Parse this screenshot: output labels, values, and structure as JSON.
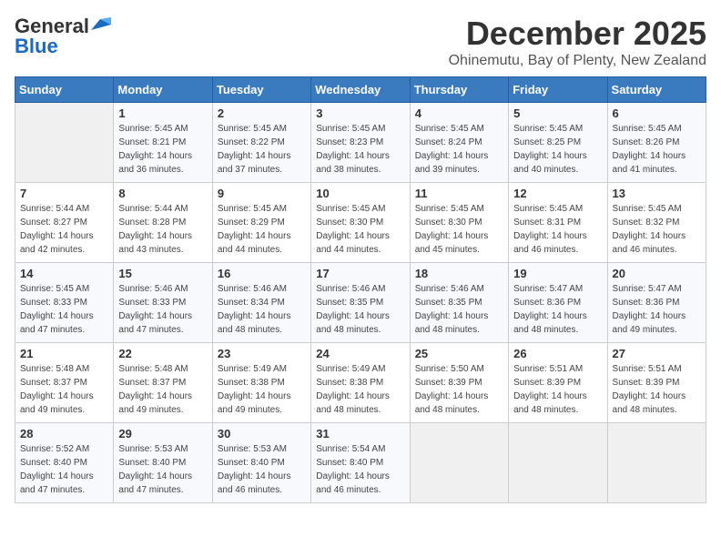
{
  "logo": {
    "line1": "General",
    "line2": "Blue"
  },
  "title": "December 2025",
  "location": "Ohinemutu, Bay of Plenty, New Zealand",
  "weekdays": [
    "Sunday",
    "Monday",
    "Tuesday",
    "Wednesday",
    "Thursday",
    "Friday",
    "Saturday"
  ],
  "weeks": [
    [
      {
        "day": null
      },
      {
        "day": 1,
        "sunrise": "5:45 AM",
        "sunset": "8:21 PM",
        "daylight": "14 hours and 36 minutes."
      },
      {
        "day": 2,
        "sunrise": "5:45 AM",
        "sunset": "8:22 PM",
        "daylight": "14 hours and 37 minutes."
      },
      {
        "day": 3,
        "sunrise": "5:45 AM",
        "sunset": "8:23 PM",
        "daylight": "14 hours and 38 minutes."
      },
      {
        "day": 4,
        "sunrise": "5:45 AM",
        "sunset": "8:24 PM",
        "daylight": "14 hours and 39 minutes."
      },
      {
        "day": 5,
        "sunrise": "5:45 AM",
        "sunset": "8:25 PM",
        "daylight": "14 hours and 40 minutes."
      },
      {
        "day": 6,
        "sunrise": "5:45 AM",
        "sunset": "8:26 PM",
        "daylight": "14 hours and 41 minutes."
      }
    ],
    [
      {
        "day": 7,
        "sunrise": "5:44 AM",
        "sunset": "8:27 PM",
        "daylight": "14 hours and 42 minutes."
      },
      {
        "day": 8,
        "sunrise": "5:44 AM",
        "sunset": "8:28 PM",
        "daylight": "14 hours and 43 minutes."
      },
      {
        "day": 9,
        "sunrise": "5:45 AM",
        "sunset": "8:29 PM",
        "daylight": "14 hours and 44 minutes."
      },
      {
        "day": 10,
        "sunrise": "5:45 AM",
        "sunset": "8:30 PM",
        "daylight": "14 hours and 44 minutes."
      },
      {
        "day": 11,
        "sunrise": "5:45 AM",
        "sunset": "8:30 PM",
        "daylight": "14 hours and 45 minutes."
      },
      {
        "day": 12,
        "sunrise": "5:45 AM",
        "sunset": "8:31 PM",
        "daylight": "14 hours and 46 minutes."
      },
      {
        "day": 13,
        "sunrise": "5:45 AM",
        "sunset": "8:32 PM",
        "daylight": "14 hours and 46 minutes."
      }
    ],
    [
      {
        "day": 14,
        "sunrise": "5:45 AM",
        "sunset": "8:33 PM",
        "daylight": "14 hours and 47 minutes."
      },
      {
        "day": 15,
        "sunrise": "5:46 AM",
        "sunset": "8:33 PM",
        "daylight": "14 hours and 47 minutes."
      },
      {
        "day": 16,
        "sunrise": "5:46 AM",
        "sunset": "8:34 PM",
        "daylight": "14 hours and 48 minutes."
      },
      {
        "day": 17,
        "sunrise": "5:46 AM",
        "sunset": "8:35 PM",
        "daylight": "14 hours and 48 minutes."
      },
      {
        "day": 18,
        "sunrise": "5:46 AM",
        "sunset": "8:35 PM",
        "daylight": "14 hours and 48 minutes."
      },
      {
        "day": 19,
        "sunrise": "5:47 AM",
        "sunset": "8:36 PM",
        "daylight": "14 hours and 48 minutes."
      },
      {
        "day": 20,
        "sunrise": "5:47 AM",
        "sunset": "8:36 PM",
        "daylight": "14 hours and 49 minutes."
      }
    ],
    [
      {
        "day": 21,
        "sunrise": "5:48 AM",
        "sunset": "8:37 PM",
        "daylight": "14 hours and 49 minutes."
      },
      {
        "day": 22,
        "sunrise": "5:48 AM",
        "sunset": "8:37 PM",
        "daylight": "14 hours and 49 minutes."
      },
      {
        "day": 23,
        "sunrise": "5:49 AM",
        "sunset": "8:38 PM",
        "daylight": "14 hours and 49 minutes."
      },
      {
        "day": 24,
        "sunrise": "5:49 AM",
        "sunset": "8:38 PM",
        "daylight": "14 hours and 48 minutes."
      },
      {
        "day": 25,
        "sunrise": "5:50 AM",
        "sunset": "8:39 PM",
        "daylight": "14 hours and 48 minutes."
      },
      {
        "day": 26,
        "sunrise": "5:51 AM",
        "sunset": "8:39 PM",
        "daylight": "14 hours and 48 minutes."
      },
      {
        "day": 27,
        "sunrise": "5:51 AM",
        "sunset": "8:39 PM",
        "daylight": "14 hours and 48 minutes."
      }
    ],
    [
      {
        "day": 28,
        "sunrise": "5:52 AM",
        "sunset": "8:40 PM",
        "daylight": "14 hours and 47 minutes."
      },
      {
        "day": 29,
        "sunrise": "5:53 AM",
        "sunset": "8:40 PM",
        "daylight": "14 hours and 47 minutes."
      },
      {
        "day": 30,
        "sunrise": "5:53 AM",
        "sunset": "8:40 PM",
        "daylight": "14 hours and 46 minutes."
      },
      {
        "day": 31,
        "sunrise": "5:54 AM",
        "sunset": "8:40 PM",
        "daylight": "14 hours and 46 minutes."
      },
      {
        "day": null
      },
      {
        "day": null
      },
      {
        "day": null
      }
    ]
  ],
  "labels": {
    "sunrise": "Sunrise:",
    "sunset": "Sunset:",
    "daylight": "Daylight:"
  }
}
